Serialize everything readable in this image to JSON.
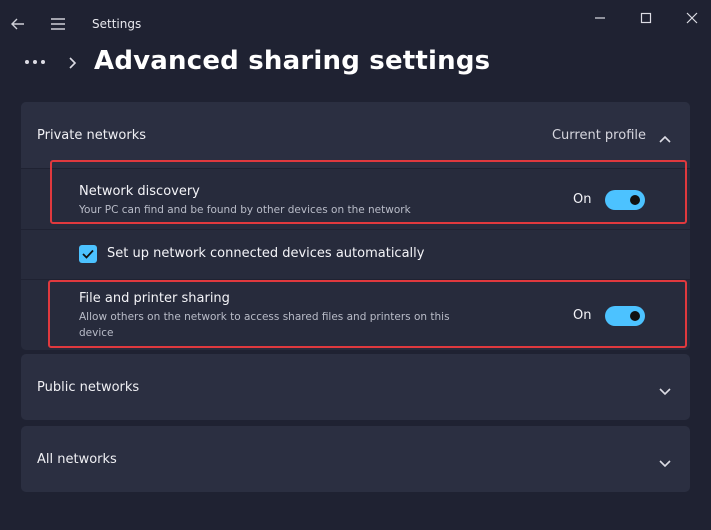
{
  "window": {
    "title": "Settings"
  },
  "breadcrumb": {
    "page_title": "Advanced sharing settings"
  },
  "private_networks": {
    "label": "Private networks",
    "status": "Current profile",
    "expanded": true,
    "settings": {
      "network_discovery": {
        "title": "Network discovery",
        "description": "Your PC can find and be found by other devices on the network",
        "state_label": "On",
        "enabled": true
      },
      "auto_setup": {
        "label": "Set up network connected devices automatically",
        "checked": true
      },
      "file_printer_sharing": {
        "title": "File and printer sharing",
        "description": "Allow others on the network to access shared files and printers on this device",
        "state_label": "On",
        "enabled": true
      }
    }
  },
  "public_networks": {
    "label": "Public networks",
    "expanded": false
  },
  "all_networks": {
    "label": "All networks",
    "expanded": false
  },
  "colors": {
    "background": "#1f2232",
    "card": "#2b2f41",
    "accent": "#4cc2ff",
    "highlight": "#e0393e"
  },
  "icons": {
    "back": "back-arrow-icon",
    "menu": "hamburger-menu-icon",
    "minimize": "minimize-icon",
    "maximize": "maximize-icon",
    "close": "close-icon",
    "more": "more-dots-icon",
    "breadcrumb_separator": "chevron-right-icon",
    "expand": "chevron-down-icon",
    "collapse": "chevron-up-icon",
    "check": "checkmark-icon"
  }
}
